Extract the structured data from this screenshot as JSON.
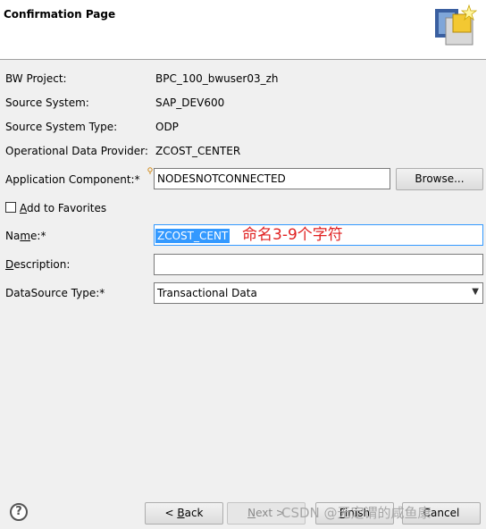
{
  "header": {
    "title": "Confirmation Page",
    "icon": "wizard-icon"
  },
  "info": {
    "bw_project_label": "BW Project:",
    "bw_project_value": "BPC_100_bwuser03_zh",
    "source_system_label": "Source System:",
    "source_system_value": "SAP_DEV600",
    "source_system_type_label": "Source System Type:",
    "source_system_type_value": "ODP",
    "odp_label": "Operational Data Provider:",
    "odp_value": "ZCOST_CENTER"
  },
  "form": {
    "app_component_label": "Application Component:*",
    "app_component_value": "NODESNOTCONNECTED",
    "browse_label": "Browse...",
    "favorites_label_u": "A",
    "favorites_label_rest": "dd to Favorites",
    "favorites_checked": false,
    "name_label_pre": "Na",
    "name_label_u": "m",
    "name_label_post": "e:*",
    "name_value": "ZCOST_CENT",
    "annotation": "命名3-9个字符",
    "description_label_u": "D",
    "description_label_rest": "escription:",
    "description_value": "",
    "datasource_type_label": "DataSource Type:*",
    "datasource_type_value": "Transactional Data"
  },
  "footer": {
    "back_prefix": "< ",
    "back_u": "B",
    "back_rest": "ack",
    "next_u": "N",
    "next_rest": "ext >",
    "finish_u": "F",
    "finish_rest": "inish",
    "cancel_label": "Cancel",
    "watermark": "CSDN @无定谓的咸鱼康"
  }
}
